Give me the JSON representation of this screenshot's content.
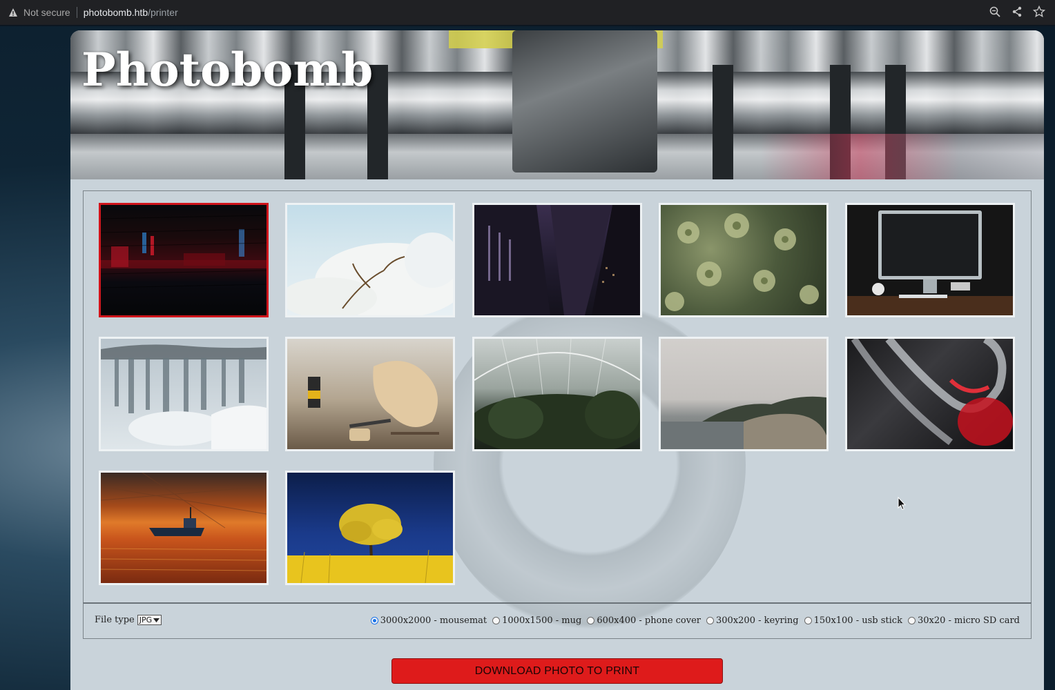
{
  "browser": {
    "security_label": "Not secure",
    "host": "photobomb.htb",
    "path": "/printer"
  },
  "header": {
    "title": "Photobomb"
  },
  "gallery": {
    "selected_index": 0,
    "photos": [
      {
        "subject": "dark red light blur"
      },
      {
        "subject": "white magnolia blossoms"
      },
      {
        "subject": "skyscrapers at night"
      },
      {
        "subject": "green succulent plants"
      },
      {
        "subject": "desktop computer on desk"
      },
      {
        "subject": "frozen waterfall"
      },
      {
        "subject": "woodworking guitar bodies"
      },
      {
        "subject": "glasshouse conservatory"
      },
      {
        "subject": "misty coastline"
      },
      {
        "subject": "red and black curved glass"
      },
      {
        "subject": "boat at sunset"
      },
      {
        "subject": "yellow tree under blue sky"
      }
    ]
  },
  "options": {
    "file_type_label": "File type",
    "file_type_value": "JPG",
    "dimensions": [
      {
        "label": "3000x2000 - mousemat",
        "checked": true
      },
      {
        "label": "1000x1500 - mug",
        "checked": false
      },
      {
        "label": "600x400 - phone cover",
        "checked": false
      },
      {
        "label": "300x200 - keyring",
        "checked": false
      },
      {
        "label": "150x100 - usb stick",
        "checked": false
      },
      {
        "label": "30x20 - micro SD card",
        "checked": false
      }
    ]
  },
  "download_button": {
    "label": "DOWNLOAD PHOTO TO PRINT"
  }
}
